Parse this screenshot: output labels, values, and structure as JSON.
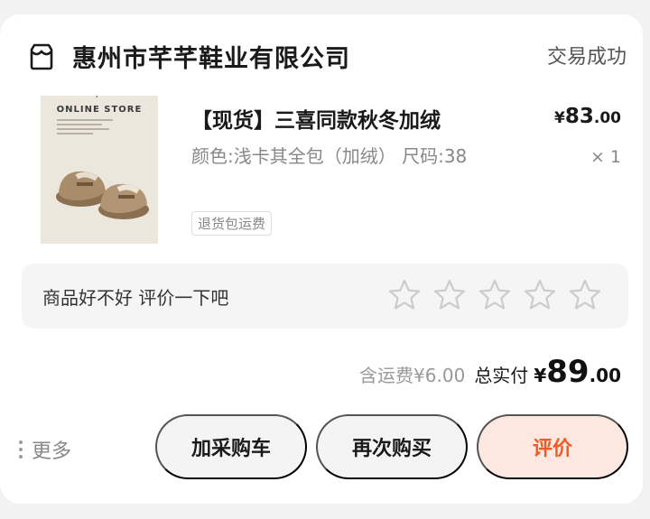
{
  "order": {
    "shop_name": "惠州市芊芊鞋业有限公司",
    "status": "交易成功",
    "product": {
      "image_text": "ONLINE STORE",
      "image_mark": "+",
      "title": "【现货】三喜同款秋冬加绒",
      "price_symbol": "¥",
      "price_int": "83",
      "price_dec": ".00",
      "spec": "颜色:浅卡其全包（加绒） 尺码:38",
      "qty": "× 1",
      "tag": "退货包运费"
    },
    "rating": {
      "prompt": "商品好不好 评价一下吧",
      "max_stars": 5,
      "current": 0
    },
    "summary": {
      "shipping": "含运费¥6.00",
      "total_label": "总实付",
      "total_symbol": "¥",
      "total_int": "89",
      "total_dec": ".00"
    },
    "actions": {
      "more": "更多",
      "add_cart": "加采购车",
      "rebuy": "再次购买",
      "review": "评价"
    }
  },
  "colors": {
    "accent": "#f05a23",
    "accent_bg": "#fde8e1",
    "star_outline": "#cccccc"
  }
}
